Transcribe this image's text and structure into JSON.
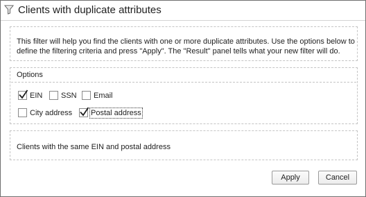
{
  "window": {
    "title": "Clients with duplicate attributes",
    "icon": "funnel-filter-icon"
  },
  "description": "This filter will help you find the clients with one or more duplicate attributes. Use the options below to define the filtering criteria and press \"Apply\". The \"Result\" panel tells what your new filter will do.",
  "options": {
    "title": "Options",
    "items": [
      {
        "label": "EIN",
        "checked": true
      },
      {
        "label": "SSN",
        "checked": false
      },
      {
        "label": "Email",
        "checked": false
      },
      {
        "label": "City address",
        "checked": false
      },
      {
        "label": "Postal address",
        "checked": true
      }
    ]
  },
  "result": {
    "text": "Clients with the same EIN and postal address"
  },
  "buttons": {
    "apply": "Apply",
    "cancel": "Cancel"
  }
}
